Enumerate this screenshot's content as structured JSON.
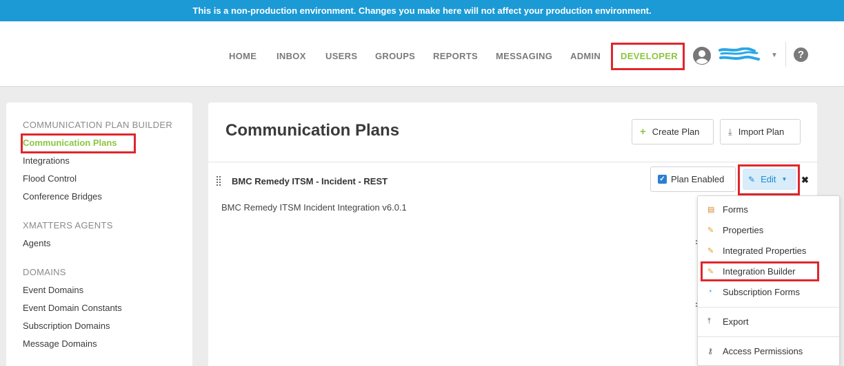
{
  "banner": {
    "text": "This is a non-production environment. Changes you make here will not affect your production environment."
  },
  "nav": {
    "items": [
      "HOME",
      "INBOX",
      "USERS",
      "GROUPS",
      "REPORTS",
      "MESSAGING",
      "ADMIN",
      "DEVELOPER"
    ],
    "active": "DEVELOPER",
    "help": "?"
  },
  "sidebar": {
    "sections": [
      {
        "heading": "COMMUNICATION PLAN BUILDER",
        "items": [
          "Communication Plans",
          "Integrations",
          "Flood Control",
          "Conference Bridges"
        ]
      },
      {
        "heading": "XMATTERS AGENTS",
        "items": [
          "Agents"
        ]
      },
      {
        "heading": "DOMAINS",
        "items": [
          "Event Domains",
          "Event Domain Constants",
          "Subscription Domains",
          "Message Domains"
        ]
      }
    ],
    "active": "Communication Plans"
  },
  "main": {
    "title": "Communication Plans",
    "create_label": "Create Plan",
    "import_label": "Import Plan",
    "plan": {
      "name": "BMC Remedy ITSM - Incident - REST",
      "description": "BMC Remedy ITSM Incident Integration v6.0.1",
      "enabled_label": "Plan Enabled",
      "enabled": true,
      "edit_label": "Edit",
      "remove": "✖"
    }
  },
  "dropdown": {
    "items": [
      "Forms",
      "Properties",
      "Integrated Properties",
      "Integration Builder",
      "Subscription Forms",
      "Export",
      "Access Permissions"
    ],
    "icons": [
      "forms-icon",
      "pencil-icon",
      "pencil-icon",
      "pencil-icon",
      "rss-icon",
      "upload-icon",
      "key-icon"
    ]
  },
  "colors": {
    "banner": "#1b9ad6",
    "accent": "#8cc63f",
    "highlight": "#e0262b",
    "link": "#1d8ad3"
  }
}
